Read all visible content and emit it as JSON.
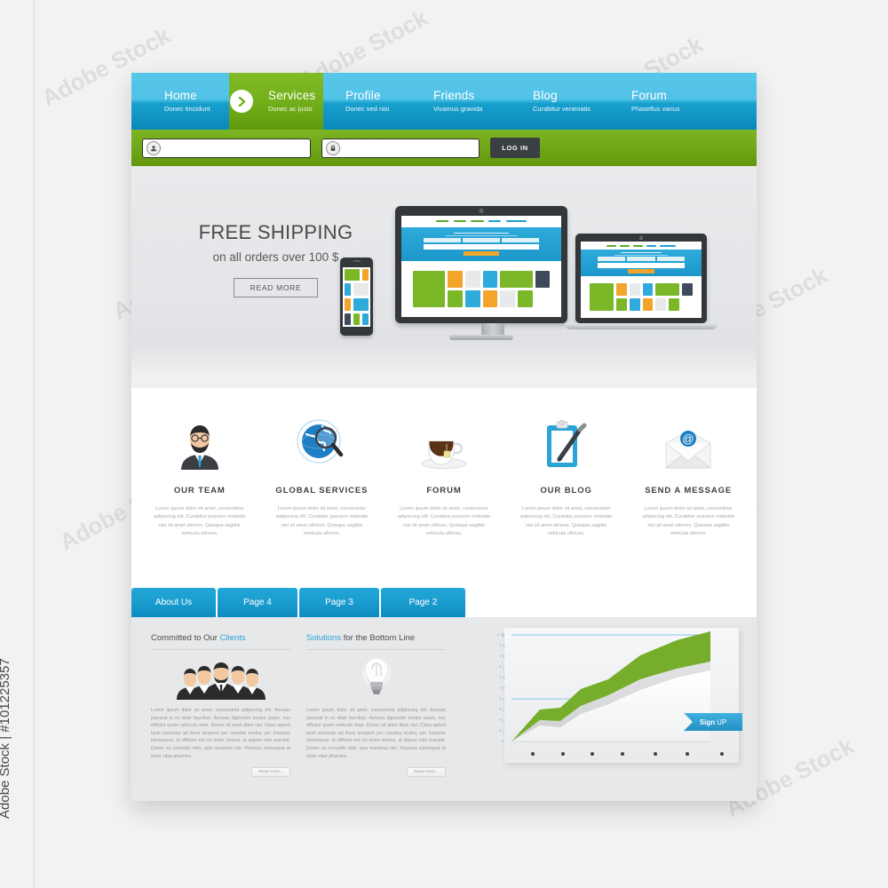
{
  "watermark": {
    "side_text": "Adobe Stock | #101225357",
    "tiles": [
      "Adobe Stock",
      "Adobe Stock",
      "Adobe Stock",
      "Adobe Stock",
      "Adobe Stock",
      "Adobe Stock",
      "Adobe Stock",
      "Adobe Stock",
      "Adobe Stock",
      "Adobe Stock",
      "Adobe Stock",
      "Adobe Stock"
    ]
  },
  "colors": {
    "nav_blue_light": "#56c6e9",
    "nav_blue_dark": "#0b87bb",
    "active_green": "#74b01c",
    "login_green": "#6ea617",
    "tab_blue": "#1b9ccf",
    "accent_blue": "#2aa4d6",
    "chart_green": "#76ad2a",
    "login_button": "#3a3f44"
  },
  "nav": {
    "items": [
      {
        "title": "Home",
        "subtitle": "Donec tincidunt",
        "active": false
      },
      {
        "title": "Services",
        "subtitle": "Donec ac justo",
        "active": true
      },
      {
        "title": "Profile",
        "subtitle": "Donec sed nisi",
        "active": false
      },
      {
        "title": "Friends",
        "subtitle": "Vivamus gravida",
        "active": false
      },
      {
        "title": "Blog",
        "subtitle": "Curabitur venenatis",
        "active": false
      },
      {
        "title": "Forum",
        "subtitle": "Phasellus varius",
        "active": false
      }
    ],
    "active_marker_icon": "chevron-right-icon"
  },
  "login": {
    "username": {
      "value": "",
      "placeholder": "",
      "icon": "user-icon"
    },
    "password": {
      "value": "",
      "placeholder": "",
      "icon": "lock-icon"
    },
    "button_label": "LOG IN"
  },
  "hero": {
    "headline": "FREE SHIPPING",
    "subheadline": "on all orders over 100 $",
    "button_label": "READ MORE",
    "devices": [
      "smartphone",
      "desktop-monitor",
      "laptop"
    ]
  },
  "features": [
    {
      "icon": "businessman-avatar-icon",
      "title": "OUR TEAM",
      "text": "Lorem ipsum dolor sit amet, consectetur adipiscing elit. Curabitur posuere molestie nisi sit amet ultrices. Quisque sagittis vehicula ultrices."
    },
    {
      "icon": "globe-magnifier-icon",
      "title": "GLOBAL SERVICES",
      "text": "Lorem ipsum dolor sit amet, consectetur adipiscing elit. Curabitur posuere molestie nisi sit amet ultrices. Quisque sagittis vehicula ultrices."
    },
    {
      "icon": "tea-cup-icon",
      "title": "FORUM",
      "text": "Lorem ipsum dolor sit amet, consectetur adipiscing elit. Curabitur posuere molestie nisi sit amet ultrices. Quisque sagittis vehicula ultrices."
    },
    {
      "icon": "clipboard-pen-icon",
      "title": "OUR BLOG",
      "text": "Lorem ipsum dolor sit amet, consectetur adipiscing elit. Curabitur posuere molestie nisi sit amet ultrices. Quisque sagittis vehicula ultrices."
    },
    {
      "icon": "email-envelope-icon",
      "title": "SEND  A  MESSAGE",
      "text": "Lorem ipsum dolor sit amet, consectetur adipiscing elit. Curabitur posuere molestie nisi sit amet ultrices. Quisque sagittis vehicula ultrices."
    }
  ],
  "tabs": [
    {
      "label": "About Us",
      "active": true
    },
    {
      "label": "Page 4",
      "active": false
    },
    {
      "label": "Page 3",
      "active": false
    },
    {
      "label": "Page 2",
      "active": false
    }
  ],
  "bottom": {
    "columns": [
      {
        "heading_plain": "Committed to Our ",
        "heading_accent": "Clients",
        "icon": "team-group-icon",
        "text": "Lorem ipsum dolor sit amet, consectetur adipiscing elit. Aenean placerat in ex vitae faucibus. Aenean dignissim ornare quam, non efficitur quam vehicula vitae. Donec sit amet diam nisi. Class aptent taciti sociosqu ad litora torquent per conubia nostra, per inceptos himenaeos. In efficitur est vel tortor viverra, at aliquet odio suscipit. Donec eu convallis nibh, quis maximus nisi. Vivamus consequat at dolor vitae pharetra.",
        "button_label": "Read more..."
      },
      {
        "heading_accent": "Solutions",
        "heading_plain": " for the Bottom Line",
        "icon": "lightbulb-icon",
        "text": "Lorem ipsum dolor sit amet, consectetur adipiscing elit. Aenean placerat in ex vitae faucibus. Aenean dignissim ornare quam, non efficitur quam vehicula vitae. Donec sit amet diam nisi. Class aptent taciti sociosqu ad litora torquent per conubia nostra, per inceptos himenaeos. In efficitur est vel tortor viverra, at aliquet odio suscipit. Donec eu convallis nibh, quis maximus nisi. Vivamus consequat at dolor vitae pharetra.",
        "button_label": "Read more..."
      }
    ],
    "signup_badge": {
      "bold": "Sign",
      "light": "UP"
    }
  },
  "chart_data": {
    "type": "area",
    "title": "",
    "xlabel": "",
    "ylabel": "",
    "ylim": [
      0,
      100
    ],
    "grid": true,
    "gridlines_at": [
      50,
      100
    ],
    "legend": "none",
    "tick_labels": [
      "0",
      "10",
      "20",
      "30",
      "40",
      "50",
      "60",
      "70",
      "80",
      "90",
      "100"
    ],
    "tick_marker": "+",
    "x": [
      0,
      1,
      2,
      3,
      4,
      5,
      6,
      7
    ],
    "series": [
      {
        "name": "green-area",
        "color": "#76ad2a",
        "values": [
          0,
          30,
          32,
          48,
          58,
          78,
          92,
          100
        ]
      },
      {
        "name": "grey-area",
        "color": "#d8d9db",
        "values": [
          0,
          15,
          30,
          34,
          45,
          58,
          70,
          80
        ]
      },
      {
        "name": "white-area",
        "color": "#fbfbfc",
        "values": [
          0,
          12,
          26,
          30,
          40,
          52,
          66,
          74
        ]
      }
    ],
    "x_dot_count": 7
  }
}
